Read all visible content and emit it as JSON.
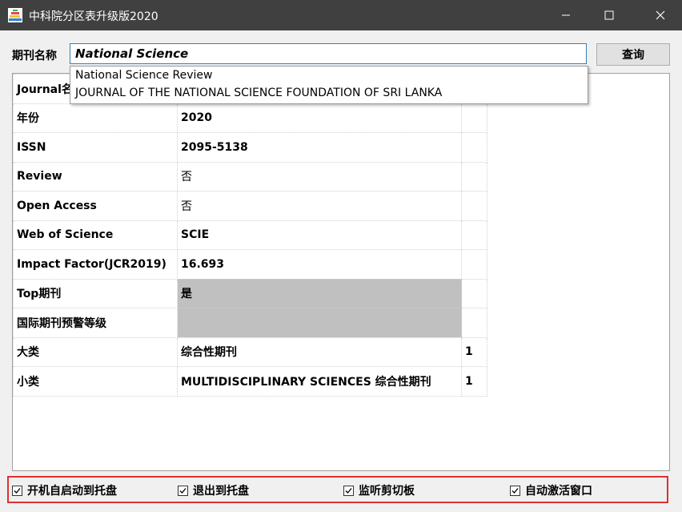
{
  "window": {
    "title": "中科院分区表升级版2020",
    "icons": [
      "minimize-icon",
      "maximize-icon",
      "close-icon"
    ]
  },
  "search": {
    "label": "期刊名称",
    "value": "National Science",
    "button_label": "查询"
  },
  "suggestions": [
    "National Science Review",
    "JOURNAL OF THE NATIONAL SCIENCE FOUNDATION OF SRI LANKA"
  ],
  "rows": [
    {
      "key": "Journal名",
      "value": "",
      "extra": ""
    },
    {
      "key": "年份",
      "value": "2020",
      "extra": ""
    },
    {
      "key": "ISSN",
      "value": "2095-5138",
      "extra": ""
    },
    {
      "key": "Review",
      "value": "否",
      "extra": ""
    },
    {
      "key": "Open Access",
      "value": "否",
      "extra": ""
    },
    {
      "key": "Web of Science",
      "value": "SCIE",
      "extra": ""
    },
    {
      "key": "Impact Factor(JCR2019)",
      "value": "16.693",
      "extra": ""
    },
    {
      "key": "Top期刊",
      "value": "是",
      "extra": ""
    },
    {
      "key": "国际期刊预警等级",
      "value": "",
      "extra": ""
    },
    {
      "key": "大类",
      "value": "综合性期刊",
      "extra": "1"
    },
    {
      "key": "小类",
      "value": " MULTIDISCIPLINARY SCIENCES 综合性期刊",
      "extra": "1"
    }
  ],
  "options": [
    {
      "label": "开机自启动到托盘",
      "checked": true
    },
    {
      "label": "退出到托盘",
      "checked": true
    },
    {
      "label": "监听剪切板",
      "checked": true
    },
    {
      "label": "自动激活窗口",
      "checked": true
    }
  ],
  "colors": {
    "titlebar": "#404040",
    "highlight_border": "#e03030",
    "gray_cell": "#c0c0c0",
    "focus_border": "#3c7fb1"
  }
}
